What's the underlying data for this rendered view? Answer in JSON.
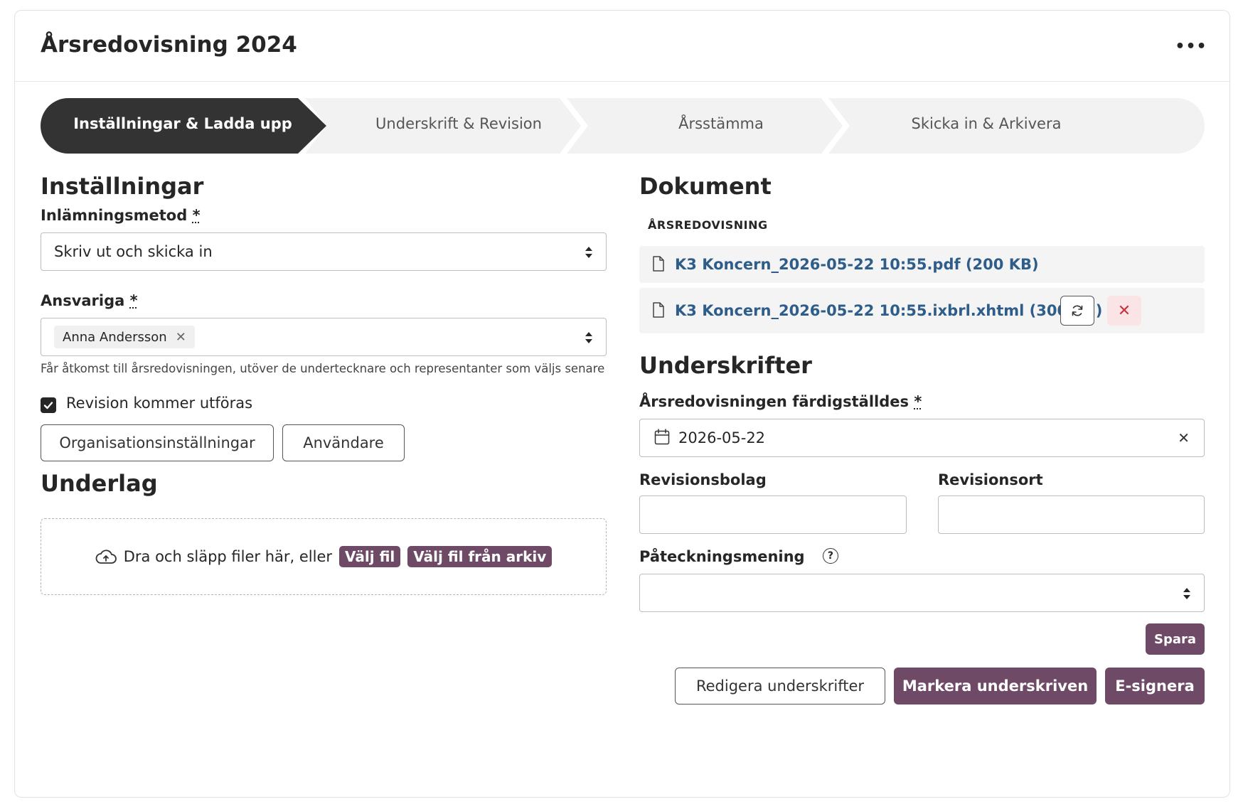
{
  "header": {
    "title": "Årsredovisning 2024",
    "more_label": "•••"
  },
  "stepper": {
    "steps": [
      {
        "label": "Inställningar & Ladda upp",
        "active": true
      },
      {
        "label": "Underskrift & Revision",
        "active": false
      },
      {
        "label": "Årsstämma",
        "active": false
      },
      {
        "label": "Skicka in & Arkivera",
        "active": false
      }
    ],
    "active_color": "#333333",
    "inactive_color": "#f2f2f2"
  },
  "settings": {
    "title": "Inställningar",
    "method_label": "Inlämningsmetod",
    "method_required": "*",
    "method_value": "Skriv ut och skicka in",
    "responsible_label": "Ansvariga",
    "responsible_required": "*",
    "responsible_chip": "Anna Andersson",
    "responsible_chip_remove": "✕",
    "responsible_help": "Får åtkomst till årsredovisningen, utöver de undertecknare och representanter som väljs senare",
    "revision_label": "Revision kommer utföras",
    "revision_checked": true,
    "org_settings_button": "Organisationsinställningar",
    "users_button": "Användare"
  },
  "underlag": {
    "title": "Underlag",
    "drop_text": "Dra och släpp filer här, eller",
    "choose_file": "Välj fil",
    "choose_from_archive": "Välj fil från arkiv"
  },
  "documents": {
    "title": "Dokument",
    "caption": "ÅRSREDOVISNING",
    "files": [
      {
        "name": "K3 Koncern_2026-05-22 10:55.pdf (200 KB)"
      },
      {
        "name": "K3 Koncern_2026-05-22 10:55.ixbrl.xhtml (300 KB)"
      }
    ],
    "remove_label": "✕"
  },
  "signatures": {
    "title": "Underskrifter",
    "completed_label": "Årsredovisningen färdigställdes",
    "completed_required": "*",
    "completed_date": "2026-05-22",
    "clear_label": "✕",
    "audit_firm_label": "Revisionsbolag",
    "audit_firm_value": "",
    "audit_place_label": "Revisionsort",
    "audit_place_value": "",
    "endorsement_label": "Påteckningsmening",
    "endorsement_help": "?",
    "endorsement_value": "",
    "save_button": "Spara",
    "edit_signatures_button": "Redigera underskrifter",
    "mark_signed_button": "Markera underskriven",
    "esign_button": "E-signera"
  },
  "colors": {
    "primary": "#6f4a67",
    "link": "#2f5d8a",
    "danger": "#c8323c",
    "danger_bg": "#fbe4e5"
  }
}
